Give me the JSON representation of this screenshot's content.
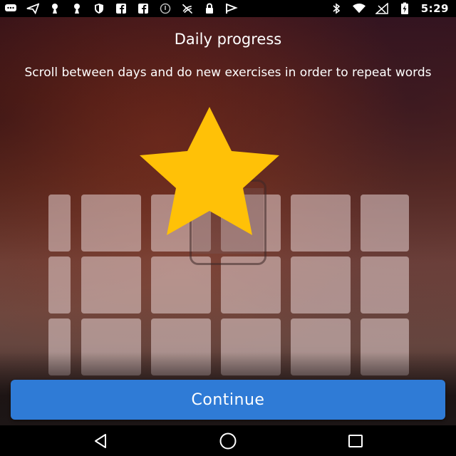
{
  "status_bar": {
    "time": "5:29",
    "left_icons": [
      "message-icon",
      "send-icon",
      "keyhole-icon",
      "keyhole-icon",
      "shield-icon",
      "facebook-icon",
      "facebook-icon",
      "info-icon",
      "no-signal-icon",
      "lock-icon",
      "flag-icon"
    ],
    "right_icons": [
      "bluetooth-icon",
      "wifi-icon",
      "cellular-icon",
      "battery-charging-icon"
    ]
  },
  "page": {
    "title": "Daily progress",
    "subtitle": "Scroll between days and do new exercises in order to repeat words"
  },
  "illustration": {
    "star_color": "#ffc107",
    "icons": [
      "star-icon",
      "phone-icon"
    ]
  },
  "continue_button": {
    "label": "Continue",
    "color": "#2f7bd6"
  },
  "nav_bar": {
    "icons": [
      "back-icon",
      "home-icon",
      "recents-icon"
    ]
  }
}
